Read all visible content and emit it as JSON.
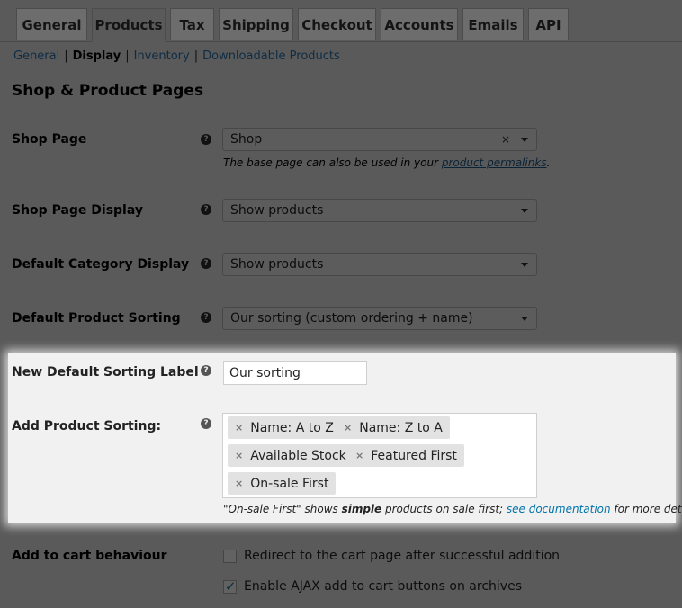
{
  "tabs": [
    {
      "label": "General"
    },
    {
      "label": "Products"
    },
    {
      "label": "Tax"
    },
    {
      "label": "Shipping"
    },
    {
      "label": "Checkout"
    },
    {
      "label": "Accounts"
    },
    {
      "label": "Emails"
    },
    {
      "label": "API"
    }
  ],
  "active_tab": "Products",
  "subnav": {
    "general": "General",
    "display": "Display",
    "inventory": "Inventory",
    "downloadable": "Downloadable Products",
    "separator": "|"
  },
  "section_title": "Shop & Product Pages",
  "shop_page": {
    "label": "Shop Page",
    "value": "Shop",
    "clear": "×",
    "desc_before": "The base page can also be used in your ",
    "desc_link": "product permalinks",
    "desc_after": "."
  },
  "shop_page_display": {
    "label": "Shop Page Display",
    "value": "Show products"
  },
  "default_category_display": {
    "label": "Default Category Display",
    "value": "Show products"
  },
  "default_product_sorting": {
    "label": "Default Product Sorting",
    "value": "Our sorting (custom ordering + name)"
  },
  "new_sorting_label": {
    "label": "New Default Sorting Label",
    "value": "Our sorting"
  },
  "add_product_sorting": {
    "label": "Add Product Sorting:",
    "chips": [
      {
        "label": "Name: A to Z"
      },
      {
        "label": "Name: Z to A"
      },
      {
        "label": "Available Stock"
      },
      {
        "label": "Featured First"
      },
      {
        "label": "On-sale First"
      }
    ],
    "chip_remove": "×",
    "desc_part1": "\"On-sale First\" shows ",
    "desc_bold": "simple",
    "desc_part2": " products on sale first; ",
    "desc_link": "see documentation",
    "desc_part3": " for more details."
  },
  "add_to_cart": {
    "label": "Add to cart behaviour",
    "options": [
      {
        "label": "Redirect to the cart page after successful addition",
        "checked": false
      },
      {
        "label": "Enable AJAX add to cart buttons on archives",
        "checked": true
      }
    ],
    "check_mark": "✓"
  },
  "help_glyph": "?"
}
